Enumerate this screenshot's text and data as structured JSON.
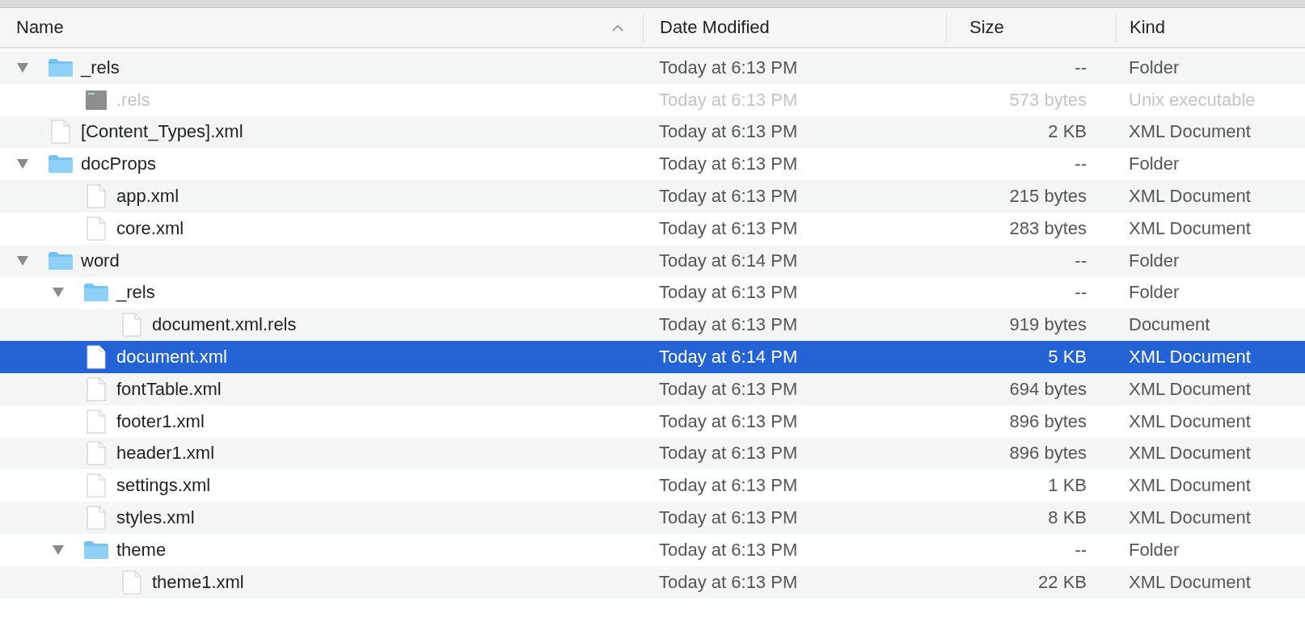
{
  "columns": [
    {
      "label": "Name",
      "sorted": true
    },
    {
      "label": "Date Modified",
      "sorted": false
    },
    {
      "label": "Size",
      "sorted": false
    },
    {
      "label": "Kind",
      "sorted": false
    }
  ],
  "items": [
    {
      "name": "_rels",
      "kind": "folder",
      "expanded": true,
      "selected": false,
      "dimmed": false,
      "date": "Today at 6:13 PM",
      "size": "--",
      "type": "Folder",
      "children": [
        {
          "name": ".rels",
          "kind": "executable",
          "selected": false,
          "dimmed": true,
          "date": "Today at 6:13 PM",
          "size": "573 bytes",
          "type": "Unix executable"
        }
      ]
    },
    {
      "name": "[Content_Types].xml",
      "kind": "file",
      "selected": false,
      "dimmed": false,
      "date": "Today at 6:13 PM",
      "size": "2 KB",
      "type": "XML Document"
    },
    {
      "name": "docProps",
      "kind": "folder",
      "expanded": true,
      "selected": false,
      "dimmed": false,
      "date": "Today at 6:13 PM",
      "size": "--",
      "type": "Folder",
      "children": [
        {
          "name": "app.xml",
          "kind": "file",
          "selected": false,
          "dimmed": false,
          "date": "Today at 6:13 PM",
          "size": "215 bytes",
          "type": "XML Document"
        },
        {
          "name": "core.xml",
          "kind": "file",
          "selected": false,
          "dimmed": false,
          "date": "Today at 6:13 PM",
          "size": "283 bytes",
          "type": "XML Document"
        }
      ]
    },
    {
      "name": "word",
      "kind": "folder",
      "expanded": true,
      "selected": false,
      "dimmed": false,
      "date": "Today at 6:14 PM",
      "size": "--",
      "type": "Folder",
      "children": [
        {
          "name": "_rels",
          "kind": "folder",
          "expanded": true,
          "selected": false,
          "dimmed": false,
          "date": "Today at 6:13 PM",
          "size": "--",
          "type": "Folder",
          "children": [
            {
              "name": "document.xml.rels",
              "kind": "file",
              "selected": false,
              "dimmed": false,
              "date": "Today at 6:13 PM",
              "size": "919 bytes",
              "type": "Document"
            }
          ]
        },
        {
          "name": "document.xml",
          "kind": "file",
          "selected": true,
          "dimmed": false,
          "date": "Today at 6:14 PM",
          "size": "5 KB",
          "type": "XML Document"
        },
        {
          "name": "fontTable.xml",
          "kind": "file",
          "selected": false,
          "dimmed": false,
          "date": "Today at 6:13 PM",
          "size": "694 bytes",
          "type": "XML Document"
        },
        {
          "name": "footer1.xml",
          "kind": "file",
          "selected": false,
          "dimmed": false,
          "date": "Today at 6:13 PM",
          "size": "896 bytes",
          "type": "XML Document"
        },
        {
          "name": "header1.xml",
          "kind": "file",
          "selected": false,
          "dimmed": false,
          "date": "Today at 6:13 PM",
          "size": "896 bytes",
          "type": "XML Document"
        },
        {
          "name": "settings.xml",
          "kind": "file",
          "selected": false,
          "dimmed": false,
          "date": "Today at 6:13 PM",
          "size": "1 KB",
          "type": "XML Document"
        },
        {
          "name": "styles.xml",
          "kind": "file",
          "selected": false,
          "dimmed": false,
          "date": "Today at 6:13 PM",
          "size": "8 KB",
          "type": "XML Document"
        },
        {
          "name": "theme",
          "kind": "folder",
          "expanded": true,
          "selected": false,
          "dimmed": false,
          "date": "Today at 6:13 PM",
          "size": "--",
          "type": "Folder",
          "children": [
            {
              "name": "theme1.xml",
              "kind": "file",
              "selected": false,
              "dimmed": false,
              "date": "Today at 6:13 PM",
              "size": "22 KB",
              "type": "XML Document"
            }
          ]
        }
      ]
    }
  ]
}
